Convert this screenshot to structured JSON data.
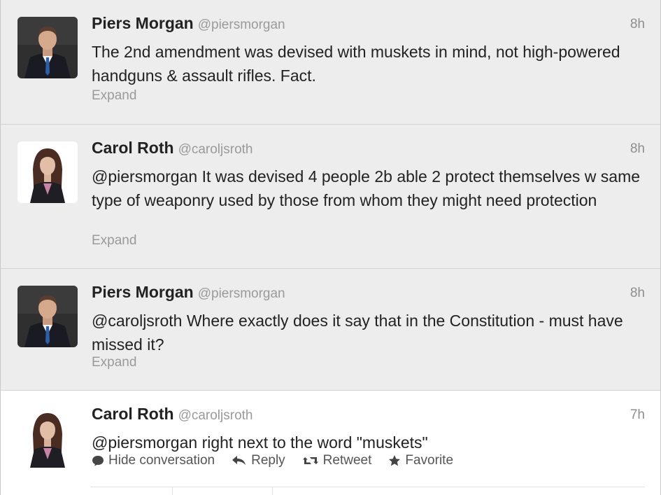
{
  "tweets": [
    {
      "fullname": "Piers Morgan",
      "username": "@piersmorgan",
      "time": "8h",
      "text": "The 2nd amendment was devised with muskets in mind, not high-powered handguns & assault rifles. Fact.",
      "expand": "Expand"
    },
    {
      "fullname": "Carol Roth",
      "username": "@caroljsroth",
      "time": "8h",
      "text": "@piersmorgan It was devised 4 people 2b able 2 protect themselves w same type of weaponry used by those from whom they might need protection",
      "expand": "Expand"
    },
    {
      "fullname": "Piers Morgan",
      "username": "@piersmorgan",
      "time": "8h",
      "text": "@caroljsroth Where exactly does it say that in the Constitution - must have missed it?",
      "expand": "Expand"
    },
    {
      "fullname": "Carol Roth",
      "username": "@caroljsroth",
      "time": "7h",
      "text": "@piersmorgan right next to the word \"muskets\"",
      "actions": {
        "hide_conversation": "Hide conversation",
        "reply": "Reply",
        "retweet": "Retweet",
        "favorite": "Favorite"
      }
    }
  ],
  "colors": {
    "background_collapsed": "#ededed",
    "background_open": "#ffffff",
    "name": "#222222",
    "meta": "#9a9a9a"
  },
  "icons": [
    "avatar-man-suit",
    "avatar-woman",
    "speech-bubble-icon",
    "reply-arrow-icon",
    "retweet-icon",
    "star-icon"
  ]
}
